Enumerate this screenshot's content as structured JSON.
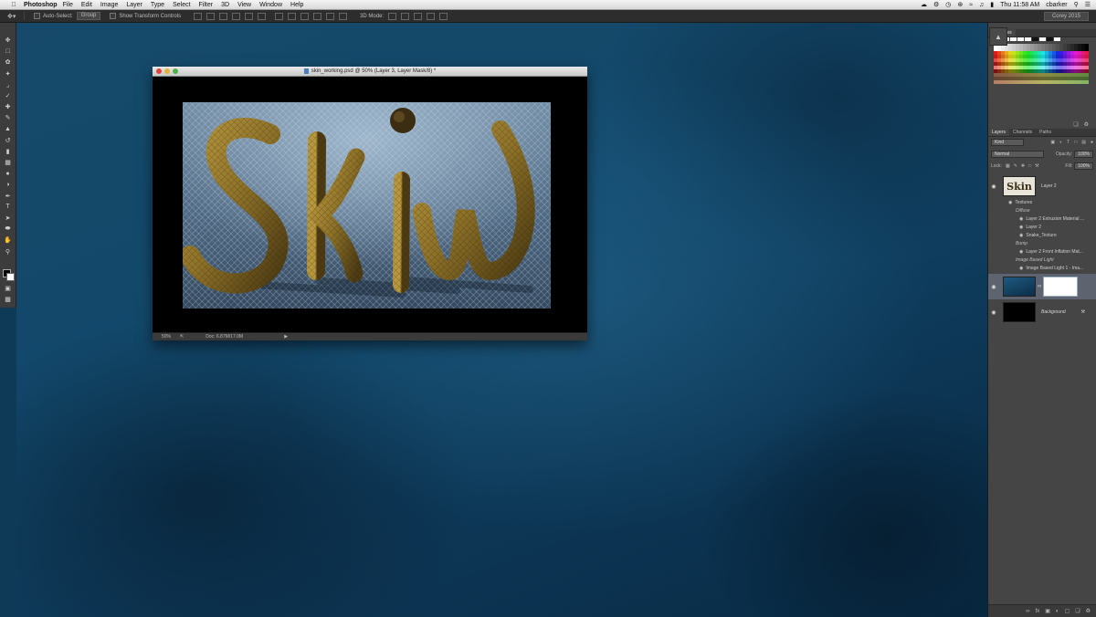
{
  "menubar": {
    "app_name": "Photoshop",
    "items": [
      "File",
      "Edit",
      "Image",
      "Layer",
      "Type",
      "Select",
      "Filter",
      "3D",
      "View",
      "Window",
      "Help"
    ],
    "clock": "Thu 11:58 AM",
    "user": "cbarker"
  },
  "options": {
    "auto_select_label": "Auto-Select:",
    "auto_select_value": "Group",
    "transform_label": "Show Transform Controls",
    "mode_label": "3D Mode:",
    "workspace": "Corey 2015"
  },
  "document": {
    "title": "skin_working.psd @ 50% (Layer 3, Layer Mask/8) *",
    "zoom": "50%",
    "doc_size": "Doc: 6.87M/17.0M"
  },
  "swatches": {
    "tab": "Swatches"
  },
  "layers": {
    "tabs": [
      "Layers",
      "Channels",
      "Paths"
    ],
    "kind": "Kind",
    "blend_mode": "Normal",
    "opacity_label": "Opacity:",
    "opacity": "100%",
    "lock_label": "Lock:",
    "fill_label": "Fill:",
    "fill": "100%",
    "layer2_name": "Layer 2",
    "thumb_text": "Skin",
    "effects": {
      "textures": "Textures",
      "diffuse": "Diffuse",
      "d1": "Layer 2 Extrusion Material ...",
      "d2": "Layer 2",
      "d3": "Snake_Texture",
      "bump": "Bump",
      "b1": "Layer 2 Front Inflation Mat...",
      "ibl": "Image Based Light",
      "ibl1": "Image Based Light 1 - Ima..."
    },
    "background_name": "Background"
  },
  "colors": {
    "accent": "#4a7fbf",
    "panel": "#454545"
  }
}
